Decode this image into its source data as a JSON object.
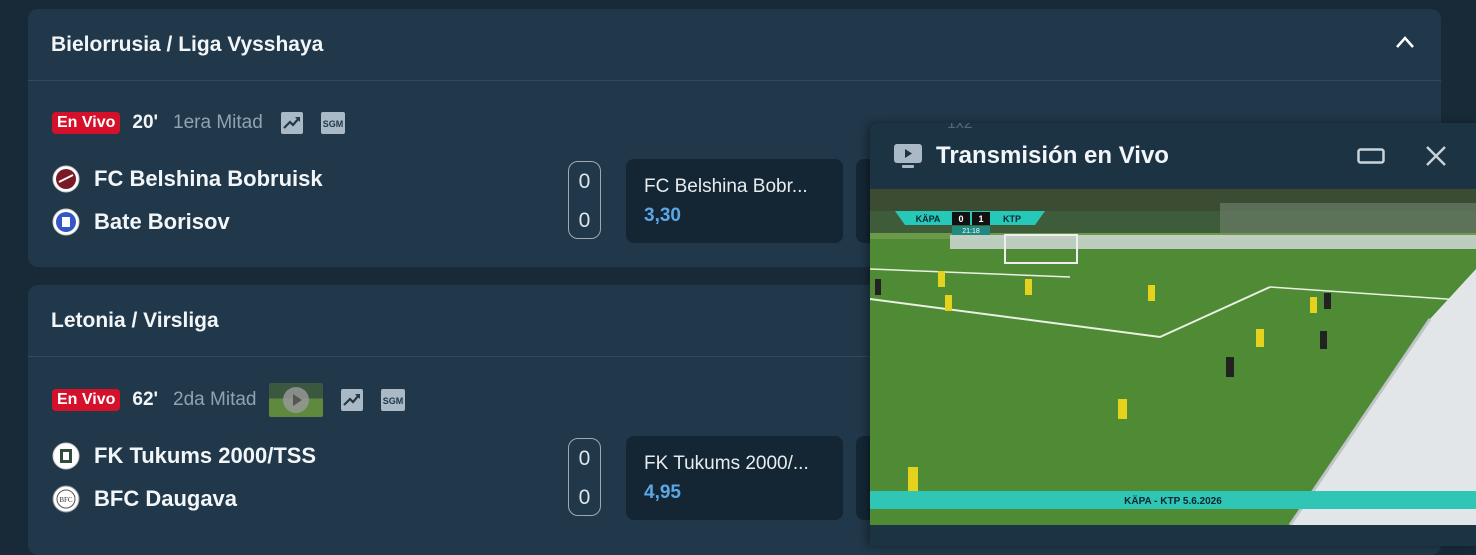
{
  "panel_header_hint": "1x2",
  "leagues": [
    {
      "title": "Bielorrusia / Liga Vysshaya",
      "status": {
        "live": "En Vivo",
        "minute": "20'",
        "period": "1era Mitad"
      },
      "home": {
        "name": "FC Belshina Bobruisk",
        "score": "0"
      },
      "away": {
        "name": "Bate Borisov",
        "score": "0"
      },
      "odd": {
        "label": "FC Belshina Bobr...",
        "value": "3,30"
      }
    },
    {
      "title": "Letonia / Virsliga",
      "status": {
        "live": "En Vivo",
        "minute": "62'",
        "period": "2da Mitad"
      },
      "home": {
        "name": "FK Tukums 2000/TSS",
        "score": "0"
      },
      "away": {
        "name": "BFC Daugava",
        "score": "0"
      },
      "odd": {
        "label": "FK Tukums 2000/...",
        "value": "4,95"
      }
    }
  ],
  "stream_panel": {
    "title": "Transmisión en Vivo",
    "scoreboard": {
      "home": "KÄPA",
      "home_score": "0",
      "away_score": "1",
      "away": "KTP",
      "clock": "21:18"
    },
    "caption": "KÄPA - KTP 5.6.2026"
  },
  "colors": {
    "background": "#182a38",
    "card": "#20384a",
    "live_badge": "#d5102b",
    "odds_value": "#5ba7e6",
    "odd_box": "#142634"
  },
  "icons": [
    "chevron-up-icon",
    "stats-trend-icon",
    "sgm-icon",
    "video-play-icon",
    "tv-icon",
    "maximize-icon",
    "close-icon"
  ]
}
